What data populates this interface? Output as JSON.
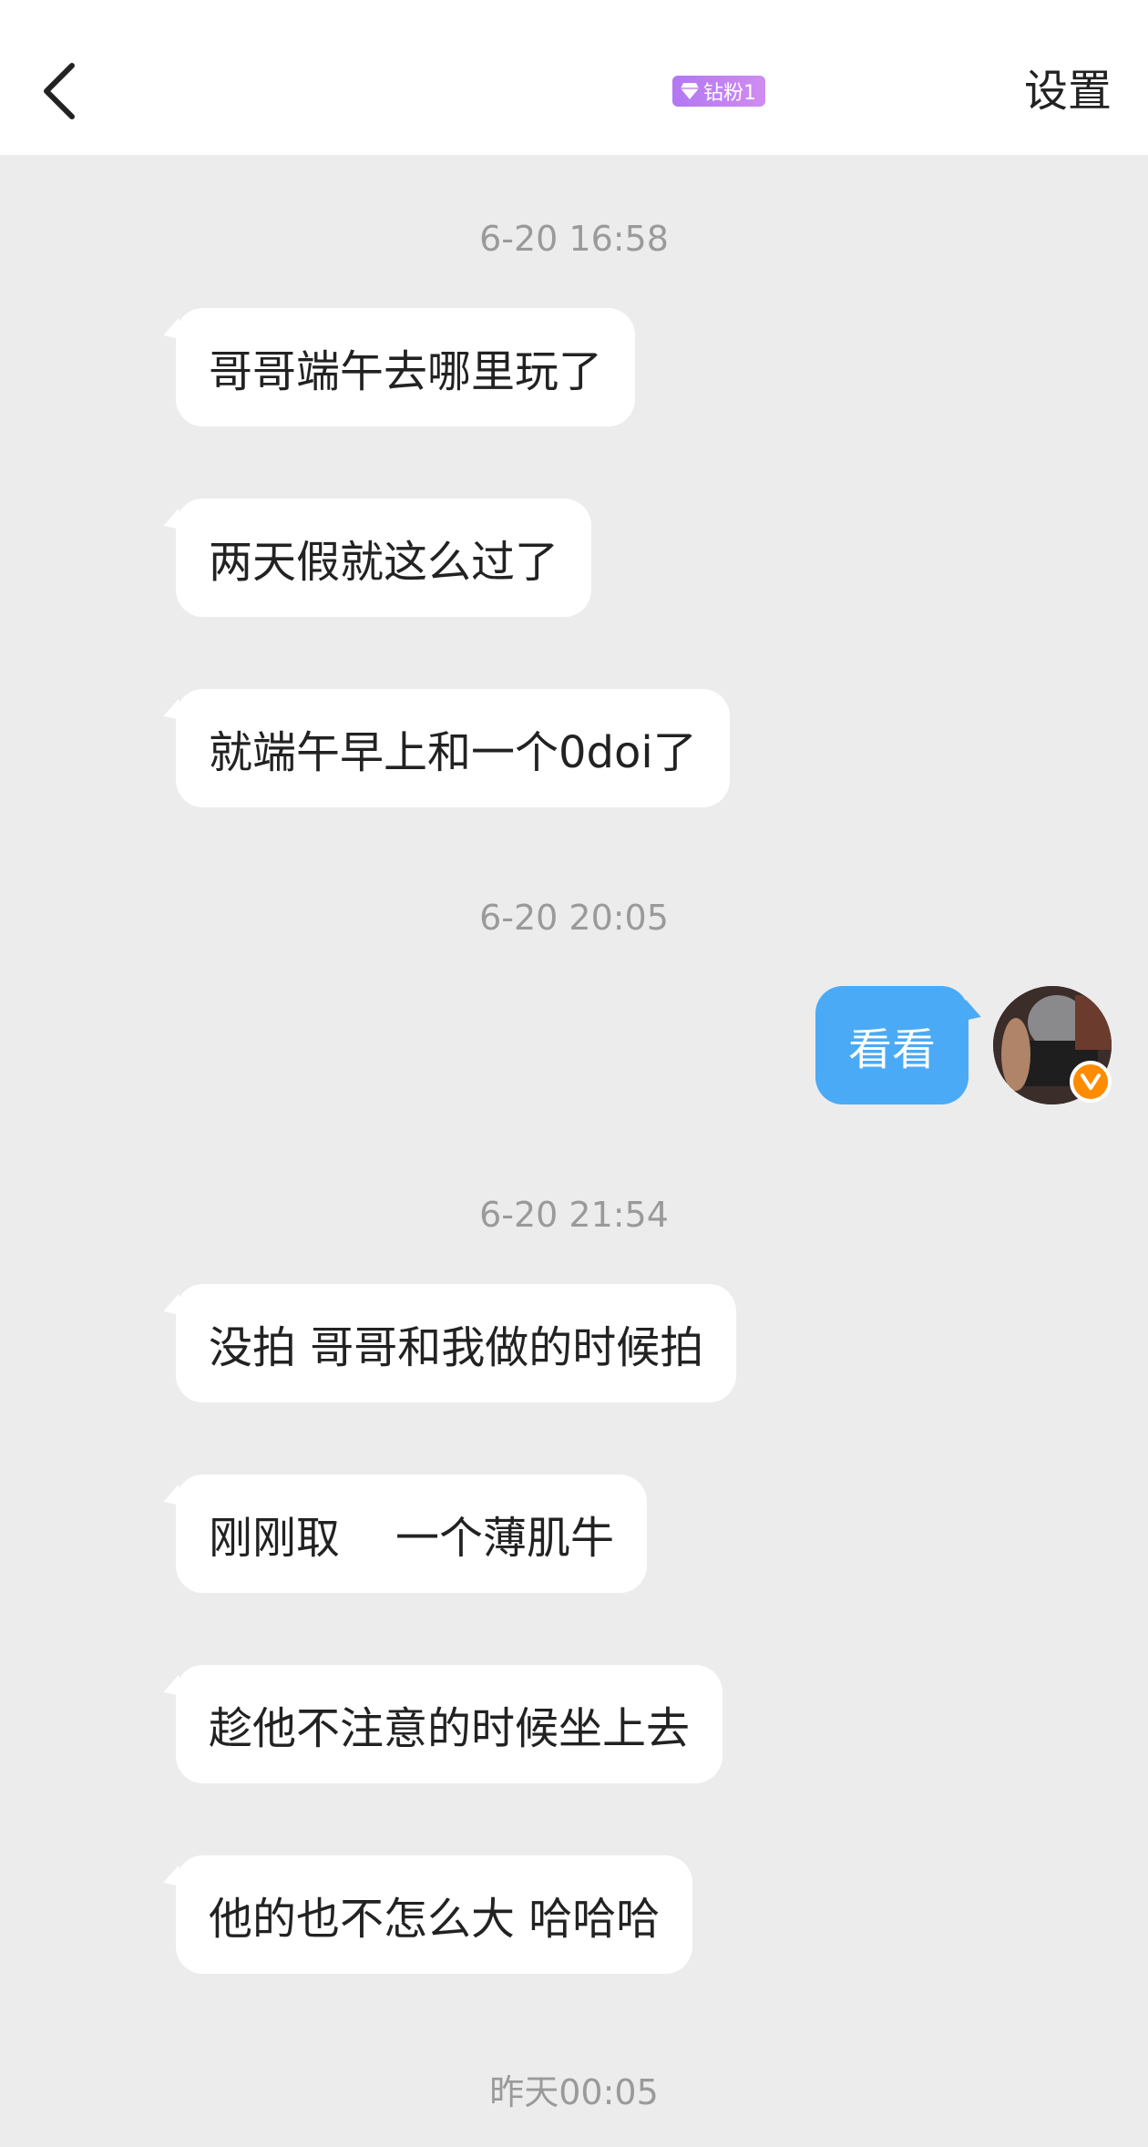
{
  "header": {
    "badge_label": "钻粉1",
    "settings_label": "设置",
    "accent_color": "#b277f2"
  },
  "messages": {
    "t1": "6-20 16:58",
    "m1": "哥哥端午去哪里玩了",
    "m2": "两天假就这么过了",
    "m3": "就端午早上和一个0doi了",
    "t2": "6-20 20:05",
    "m4": "看看",
    "t3": "6-20 21:54",
    "m5": "没拍 哥哥和我做的时候拍",
    "m6": "刚刚取    一个薄肌牛",
    "m7": "趁他不注意的时候坐上去",
    "m8": "他的也不怎么大 哈哈哈",
    "t4": "昨天00:05"
  },
  "colors": {
    "outgoing_bubble": "#4aaaf5",
    "incoming_bubble": "#ffffff",
    "background": "#ececec",
    "verified_badge": "#ff8c00"
  },
  "icons": [
    "back-arrow-icon",
    "diamond-icon",
    "verified-v-icon"
  ]
}
